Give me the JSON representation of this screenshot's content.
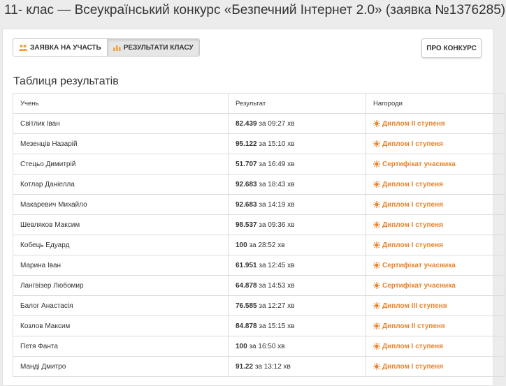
{
  "page": {
    "title": "11- клас — Всеукраїнський конкурс «Безпечний Інтернет 2.0» (заявка №1376285)"
  },
  "toolbar": {
    "apply_label": "ЗАЯВКА НА УЧАСТЬ",
    "results_label": "РЕЗУЛЬТАТИ КЛАСУ",
    "about_label": "ПРО КОНКУРС"
  },
  "results": {
    "heading": "Таблиця результатів",
    "columns": {
      "student": "Учень",
      "result": "Результат",
      "awards": "Нагороди"
    },
    "rows": [
      {
        "name": "Світлик Іван",
        "score": "82.439",
        "time": "за 09:27 хв",
        "award": "Диплом ІІ ступеня"
      },
      {
        "name": "Мезенців Назарій",
        "score": "95.122",
        "time": "за 15:10 хв",
        "award": "Диплом І ступеня"
      },
      {
        "name": "Стецьо Димитрій",
        "score": "51.707",
        "time": "за 16:49 хв",
        "award": "Сертифікат учасника"
      },
      {
        "name": "Котлар Даніелла",
        "score": "92.683",
        "time": "за 18:43 хв",
        "award": "Диплом І ступеня"
      },
      {
        "name": "Макаревич Михайло",
        "score": "92.683",
        "time": "за 14:19 хв",
        "award": "Диплом І ступеня"
      },
      {
        "name": "Шевляков Максим",
        "score": "98.537",
        "time": "за 09:36 хв",
        "award": "Диплом І ступеня"
      },
      {
        "name": "Кобець Едуард",
        "score": "100",
        "time": "за 28:52 хв",
        "award": "Диплом І ступеня"
      },
      {
        "name": "Марина Іван",
        "score": "61.951",
        "time": "за 12:45 хв",
        "award": "Сертифікат учасника"
      },
      {
        "name": "Лангвізер Любомир",
        "score": "64.878",
        "time": "за 14:53 хв",
        "award": "Сертифікат учасника"
      },
      {
        "name": "Балог Анастасія",
        "score": "76.585",
        "time": "за 12:27 хв",
        "award": "Диплом ІІІ ступеня"
      },
      {
        "name": "Козлов Максим",
        "score": "84.878",
        "time": "за 15:15 хв",
        "award": "Диплом ІІ ступеня"
      },
      {
        "name": "Петя Фанта",
        "score": "100",
        "time": "за 16:50 хв",
        "award": "Диплом І ступеня"
      },
      {
        "name": "Манді Дмитро",
        "score": "91.22",
        "time": "за 13:12 хв",
        "award": "Диплом І ступеня"
      }
    ]
  },
  "colors": {
    "accent": "#e8842c"
  },
  "icons": {
    "apply": "users-icon",
    "results": "bar-chart-icon",
    "award": "sun-icon"
  }
}
